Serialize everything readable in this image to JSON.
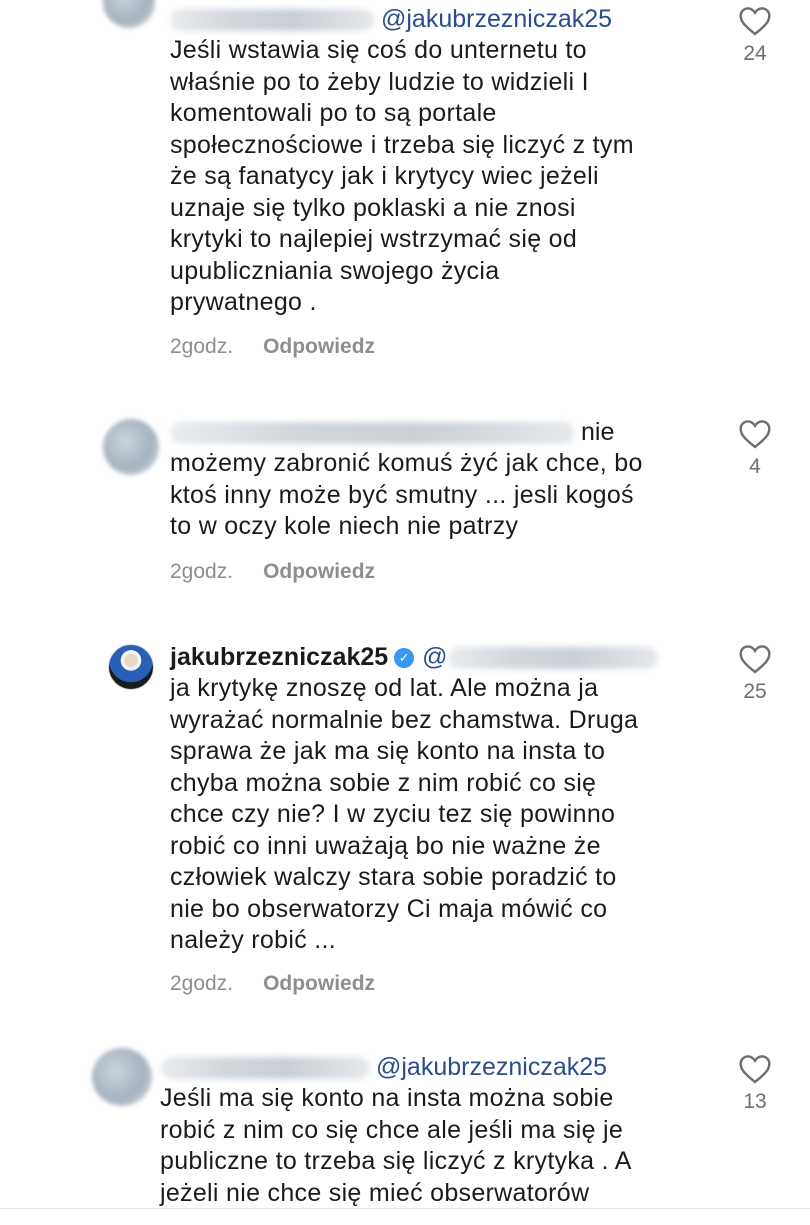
{
  "comments": [
    {
      "mention": "@jakubrzezniczak25",
      "lines": [
        "Jeśli wstawia się coś do unternetu to",
        "właśnie po to żeby ludzie to widzieli I",
        "komentowali po to są portale",
        "społecznościowe i trzeba się liczyć z tym",
        "że są fanatycy jak i krytycy wiec jeżeli",
        "uznaje się tylko poklaski a nie znosi",
        "krytyki to najlepiej wstrzymać się od",
        "upubliczniania swojego życia",
        "prywatnego ."
      ],
      "time": "2godz.",
      "reply_label": "Odpowiedz",
      "likes": "24"
    },
    {
      "first_word": "nie",
      "lines": [
        "możemy zabronić komuś żyć jak chce, bo",
        "ktoś inny może być smutny ... jesli kogoś",
        "to w oczy kole niech nie patrzy"
      ],
      "time": "2godz.",
      "reply_label": "Odpowiedz",
      "likes": "4"
    },
    {
      "username": "jakubrzezniczak25",
      "mention_prefix": "@",
      "lines": [
        "ja krytykę znoszę od lat. Ale można ja",
        "wyrażać normalnie bez chamstwa. Druga",
        "sprawa że jak ma się konto na insta to",
        "chyba można sobie z nim robić co się",
        "chce czy nie? I w zyciu tez się powinno",
        "robić co inni uważają bo nie ważne że",
        "człowiek walczy stara sobie poradzić to",
        "nie bo obserwatorzy Ci maja mówić co",
        "należy robić ..."
      ],
      "time": "2godz.",
      "reply_label": "Odpowiedz",
      "likes": "25"
    },
    {
      "mention": "@jakubrzezniczak25",
      "lines": [
        "Jeśli ma się konto na insta można sobie",
        "robić z nim co się  chce ale jeśli ma się je",
        "publiczne to trzeba się liczyć z krytyka . A",
        "jeżeli nie chce się mieć obserwatorów"
      ],
      "likes": "13"
    }
  ],
  "colors": {
    "mention": "#2b4d8a",
    "meta": "#8e8e8e",
    "verified": "#3897f0"
  }
}
